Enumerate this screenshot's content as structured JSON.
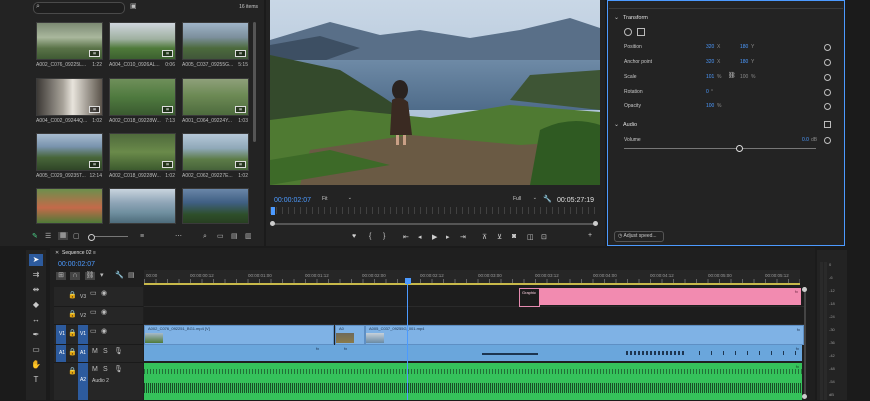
{
  "colors": {
    "accent": "#4c9aff",
    "video_clip": "#7fb2e5",
    "audio_clip": "#35c25b",
    "graphic_clip": "#f28bb0",
    "playhead": "#4c9aff"
  },
  "media_bin": {
    "item_count": "16 items",
    "search_icon": "search-icon",
    "folder_icon": "folder-icon",
    "clips": [
      {
        "name": "A002_C076_09225L...",
        "duration": "1:22"
      },
      {
        "name": "A004_C010_0926AL...",
        "duration": "0:06"
      },
      {
        "name": "A005_C037_09255G...",
        "duration": "5:15"
      },
      {
        "name": "A004_C002_09244Q...",
        "duration": "1:02"
      },
      {
        "name": "A002_C018_09228W...",
        "duration": "7:13"
      },
      {
        "name": "A001_C064_09224Y...",
        "duration": "1:03"
      },
      {
        "name": "A005_C029_09235T...",
        "duration": "12:14"
      },
      {
        "name": "A002_C018_09228W...",
        "duration": "1:02"
      },
      {
        "name": "A002_C062_09227E...",
        "duration": "1:02"
      },
      {
        "name": "",
        "duration": ""
      },
      {
        "name": "",
        "duration": ""
      },
      {
        "name": "",
        "duration": ""
      }
    ]
  },
  "program": {
    "timecode": "00:00:02:07",
    "fit": "Fit",
    "quality": "Full",
    "duration": "00:05:27:19"
  },
  "effect_controls": {
    "transform_label": "Transform",
    "position_label": "Position",
    "position_x": "320",
    "position_x_unit": "X",
    "position_y": "180",
    "position_y_unit": "Y",
    "anchor_label": "Anchor point",
    "anchor_x": "320",
    "anchor_x_unit": "X",
    "anchor_y": "180",
    "anchor_y_unit": "Y",
    "scale_label": "Scale",
    "scale_val": "101",
    "scale_unit": "%",
    "scale_val2": "100",
    "scale_unit2": "%",
    "rotation_label": "Rotation",
    "rotation_val": "0",
    "rotation_unit": "°",
    "opacity_label": "Opacity",
    "opacity_val": "100",
    "opacity_unit": "%",
    "audio_label": "Audio",
    "volume_label": "Volume",
    "volume_val": "0.0",
    "volume_unit": "dB",
    "volume_level": 0.6,
    "adjust_speed": "Adjust speed..."
  },
  "timeline": {
    "sequence_name": "Sequence 02",
    "timecode": "00:00:02:07",
    "ruler": [
      "00:00",
      "00:00:00:12",
      "00:00:01:00",
      "00:00:01:12",
      "00:00:02:00",
      "00:00:02:12",
      "00:00:03:00",
      "00:00:03:12",
      "00:00:04:00",
      "00:00:04:12",
      "00:00:05:00",
      "00:00:05:12"
    ],
    "tracks": {
      "v3": "V3",
      "v2": "V2",
      "v1": "V1",
      "a1": "A1",
      "a2": "A2",
      "audio2": "Audio 2",
      "src_v1": "V1",
      "src_a1": "A1"
    },
    "clips": {
      "graphic": "Graphic",
      "v1_clip1": "A002_C076_092251_BG1.mp4 [V]",
      "v1_clip2": "A0",
      "v1_clip3": "A005_C037_09255G_001.mp4"
    },
    "meter_labels": [
      "0",
      "-6",
      "-12",
      "-18",
      "-24",
      "-30",
      "-36",
      "-42",
      "-48",
      "-54",
      "dB"
    ]
  }
}
